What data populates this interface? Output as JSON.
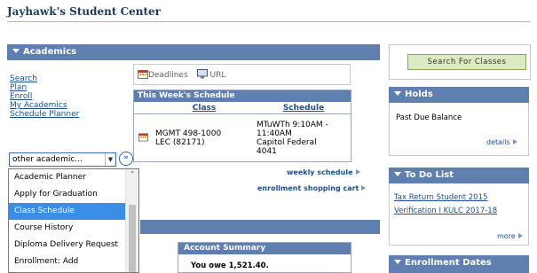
{
  "page": {
    "title": "Jayhawk's Student Center"
  },
  "academics": {
    "header": "Academics",
    "links": [
      "Search",
      "Plan",
      "Enroll",
      "My Academics",
      "Schedule Planner"
    ],
    "quick_links": {
      "deadlines": "Deadlines",
      "url": "URL"
    },
    "schedule": {
      "title": "This Week's Schedule",
      "col_class": "Class",
      "col_schedule": "Schedule",
      "rows": [
        {
          "class_line1": "MGMT 498-1000",
          "class_line2": "LEC (82171)",
          "sched_line1": "MTuWTh 9:10AM -",
          "sched_line2": "11:40AM",
          "sched_line3": "Capitol Federal",
          "sched_line4": "4041"
        }
      ]
    },
    "weekly_schedule_link": "weekly schedule",
    "shopping_cart_link": "enrollment shopping cart",
    "dropdown": {
      "selected": "other academic...",
      "options": [
        "Academic Planner",
        "Apply for Graduation",
        "Class Schedule",
        "Course History",
        "Diploma Delivery Request",
        "Enrollment: Add"
      ],
      "highlighted": "Class Schedule"
    }
  },
  "finances": {
    "account_summary_title": "Account Summary",
    "owed_text": "You owe 1,521.40."
  },
  "right": {
    "search_button": "Search For Classes",
    "holds": {
      "header": "Holds",
      "item": "Past Due Balance",
      "details": "details"
    },
    "todo": {
      "header": "To Do List",
      "items": [
        "Tax Return Student 2015",
        "Verification I KULC 2017-18"
      ],
      "more": "more"
    },
    "enrollment_dates": {
      "header": "Enrollment Dates"
    }
  },
  "colors": {
    "header_blue": "#5f7fb0",
    "link_blue": "#1d4f8f",
    "button_green": "#dbeac0"
  }
}
